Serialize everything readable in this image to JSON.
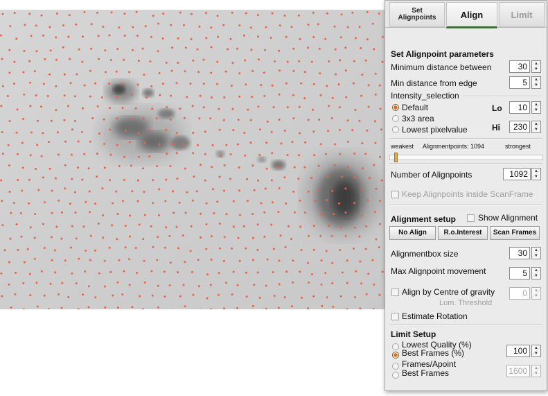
{
  "tabs": {
    "set_alignpoints": "Set Alignpoints",
    "align": "Align",
    "limit": "Limit"
  },
  "alignpoint": {
    "heading": "Set Alignpoint parameters",
    "min_distance_label": "Minimum distance between",
    "min_distance_value": "30",
    "min_edge_label": "Min distance from edge",
    "min_edge_value": "5",
    "intensity_label": "Intensity_selection",
    "opt_default": "Default",
    "opt_3x3": "3x3 area",
    "opt_lowest": "Lowest pixelvalue",
    "lo_label": "Lo",
    "lo_value": "10",
    "hi_label": "Hi",
    "hi_value": "230",
    "slider_weakest": "weakest",
    "slider_status": "Alignmentpoints: 1094",
    "slider_strongest": "strongest",
    "slider_level": 0.03,
    "number_label": "Number of Alignpoints",
    "number_value": "1092",
    "keep_inside_label": "Keep Alignpoints inside ScanFrame"
  },
  "alignment": {
    "heading": "Alignment setup",
    "show_alignment_label": "Show Alignment",
    "no_align": "No Align",
    "roi": "R.o.Interest",
    "scan_frames": "Scan Frames",
    "box_size_label": "Alignmentbox size",
    "box_size_value": "30",
    "max_move_label": "Max Alignpoint movement",
    "max_move_value": "5",
    "cog_label": "Align by Centre of gravity",
    "cog_value": "0",
    "lum_threshold": "Lum. Threshold",
    "estimate_rotation": "Estimate Rotation"
  },
  "limit": {
    "heading": "Limit Setup",
    "lowest_quality": "Lowest Quality (%)",
    "best_frames_pct": "Best Frames (%)",
    "best_frames_pct_value": "100",
    "frames_apoint": "Frames/Apoint",
    "best_frames": "Best Frames",
    "best_frames_value": "1600"
  },
  "colors": {
    "alignpoint_dot": "#e8654a",
    "active_tab_underline": "#3f6b3a",
    "radio_selected": "#e26f16"
  }
}
